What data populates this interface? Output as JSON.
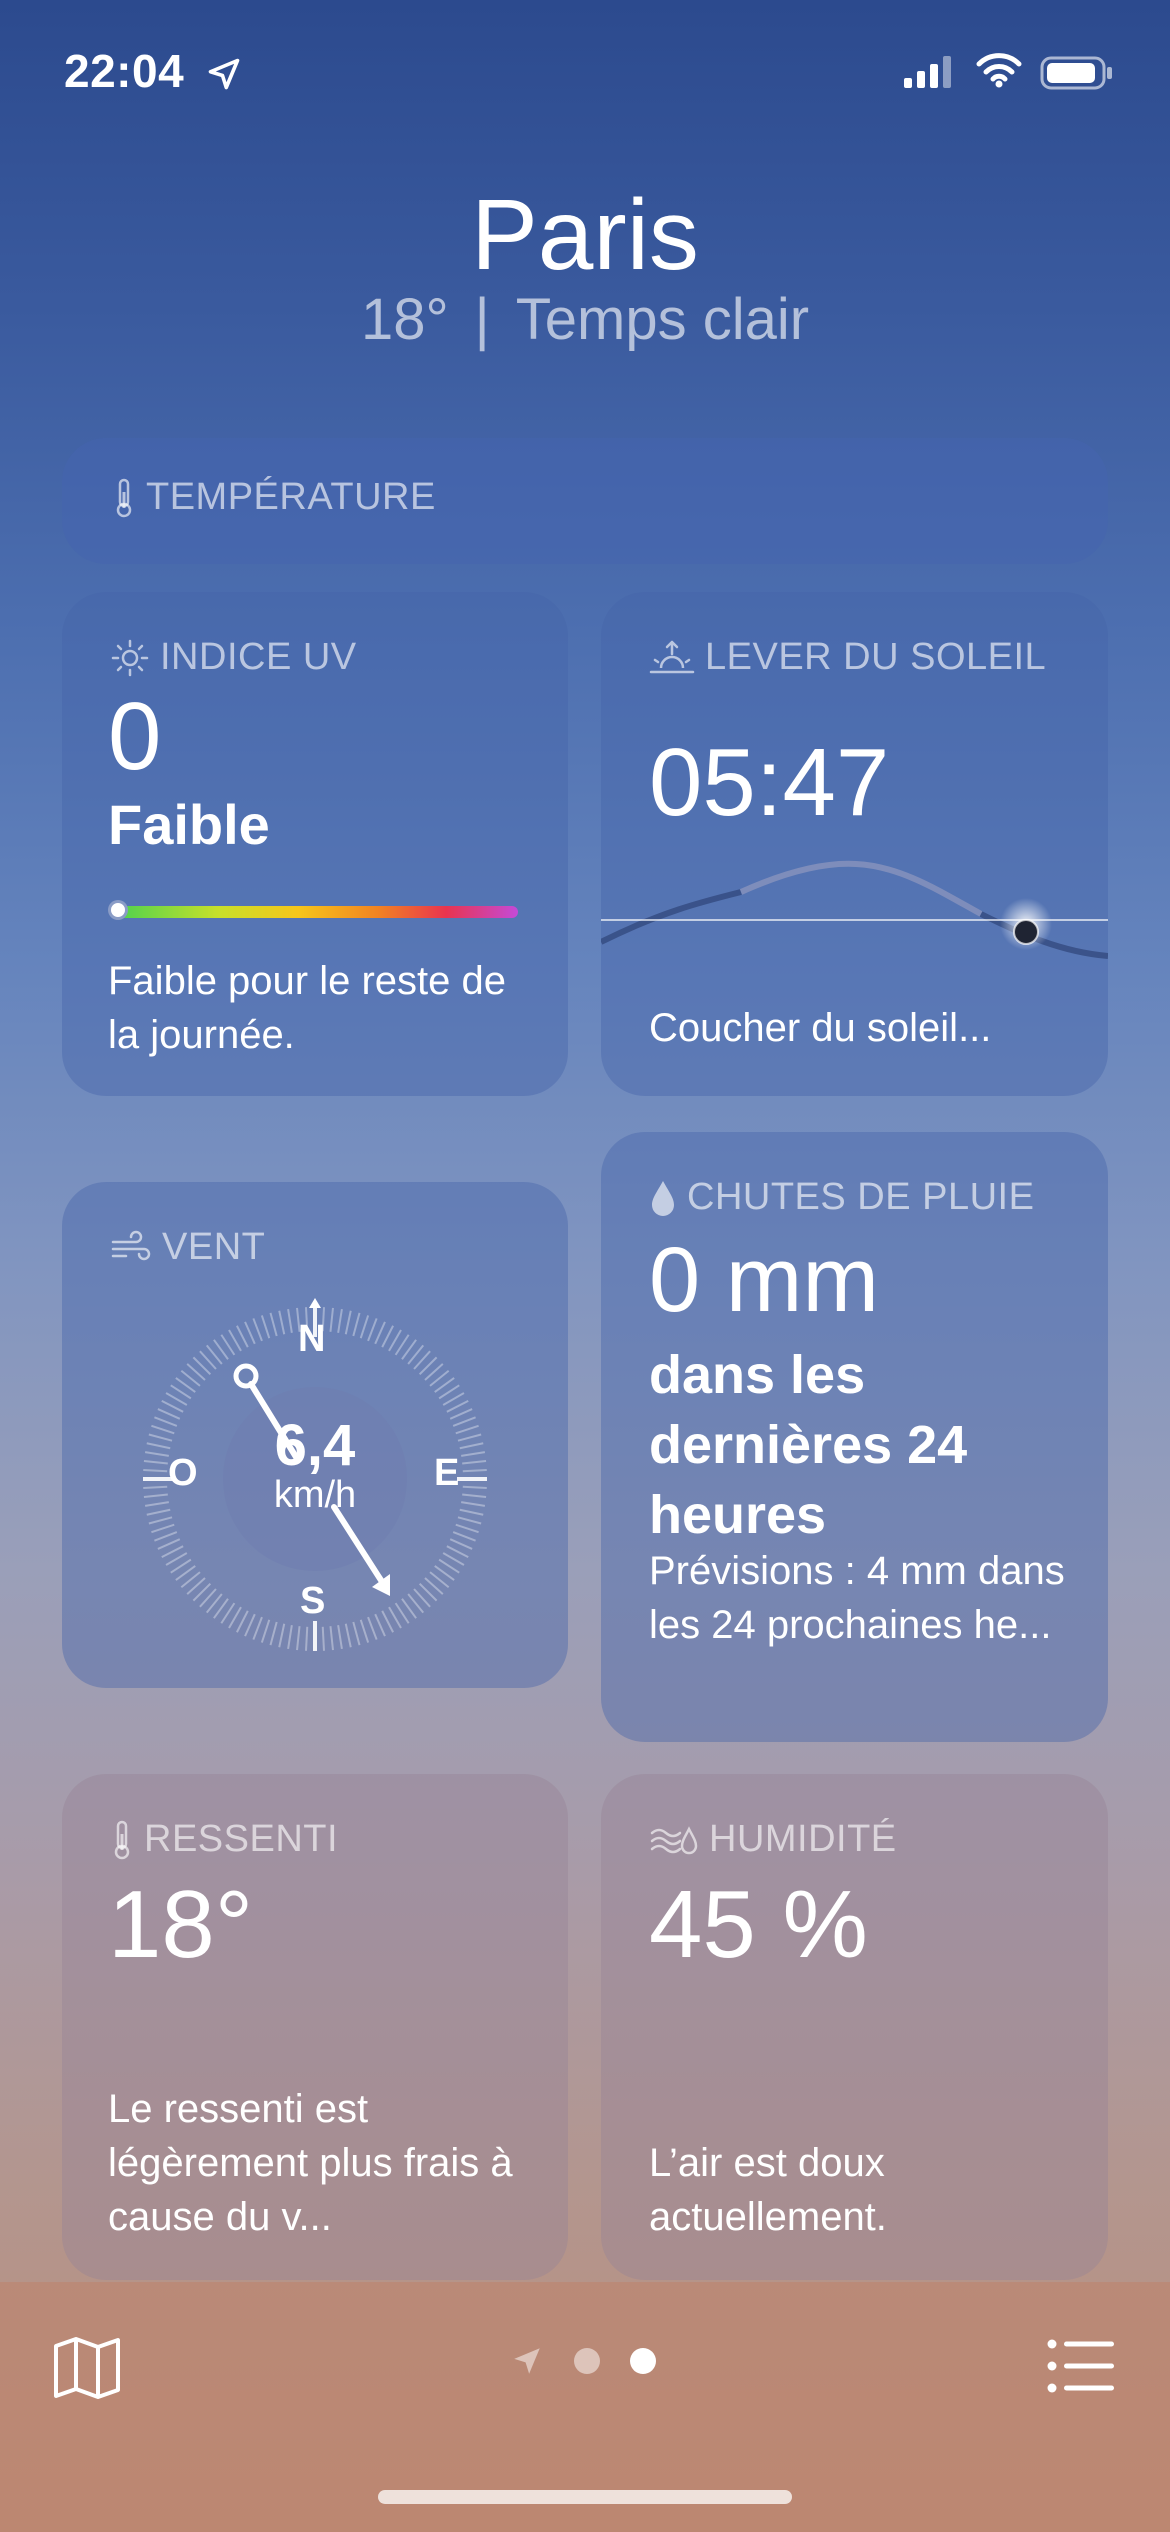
{
  "status_bar": {
    "time": "22:04"
  },
  "header": {
    "city": "Paris",
    "temperature": "18°",
    "separator": "|",
    "condition": "Temps clair"
  },
  "temperature_card": {
    "title": "TEMPÉRATURE"
  },
  "uv_card": {
    "title": "INDICE UV",
    "value": "0",
    "level": "Faible",
    "uv_fraction": 0,
    "description": "Faible pour le reste de la journée."
  },
  "sunrise_card": {
    "title": "LEVER DU SOLEIL",
    "time": "05:47",
    "description": "Coucher du soleil..."
  },
  "wind_card": {
    "title": "VENT",
    "speed": "6,4",
    "unit": "km/h",
    "directions": {
      "north": "N",
      "south": "S",
      "east": "E",
      "west": "O"
    }
  },
  "rain_card": {
    "title": "CHUTES DE PLUIE",
    "value": "0 mm",
    "period": "dans les dernières 24 heures",
    "forecast": "Prévisions : 4 mm dans les 24 prochaines he..."
  },
  "feels_like_card": {
    "title": "RESSENTI",
    "value": "18°",
    "description": "Le ressenti est légèrement plus frais à cause du v..."
  },
  "humidity_card": {
    "title": "HUMIDITÉ",
    "value": "45 %",
    "description": "L’air est doux actuellement."
  },
  "bottom_bar": {
    "icons": [
      "map-icon",
      "location-arrow-icon",
      "list-icon"
    ],
    "page_count": 3,
    "active_page": 2
  }
}
